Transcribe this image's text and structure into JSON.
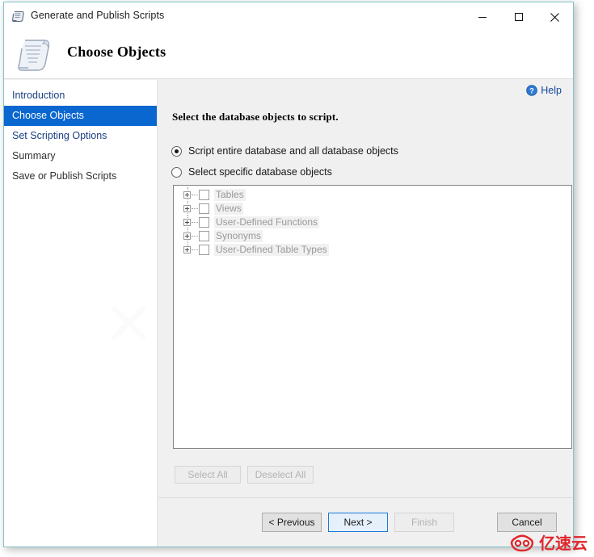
{
  "window": {
    "title": "Generate and Publish Scripts",
    "title_icon": "script-scroll-icon",
    "controls": {
      "minimize": "minimize-icon",
      "maximize": "maximize-icon",
      "close": "close-icon"
    }
  },
  "banner": {
    "heading": "Choose Objects",
    "icon": "script-scroll-large-icon"
  },
  "sidebar": {
    "items": [
      {
        "label": "Introduction",
        "selected": false
      },
      {
        "label": "Choose Objects",
        "selected": true
      },
      {
        "label": "Set Scripting Options",
        "selected": false
      },
      {
        "label": "Summary",
        "selected": false
      },
      {
        "label": "Save or Publish Scripts",
        "selected": false
      }
    ],
    "watermark_icon": "x-watermark-icon"
  },
  "content": {
    "help": {
      "label": "Help",
      "icon": "help-circle-icon"
    },
    "section_title": "Select the database objects to script.",
    "options": [
      {
        "label": "Script entire database and all database objects",
        "selected": true
      },
      {
        "label": "Select specific database objects",
        "selected": false
      }
    ],
    "tree": {
      "items": [
        {
          "label": "Tables",
          "checked": false,
          "expandable": true
        },
        {
          "label": "Views",
          "checked": false,
          "expandable": true
        },
        {
          "label": "User-Defined Functions",
          "checked": false,
          "expandable": true
        },
        {
          "label": "Synonyms",
          "checked": false,
          "expandable": true
        },
        {
          "label": "User-Defined Table Types",
          "checked": false,
          "expandable": true
        }
      ]
    },
    "select_all": {
      "label": "Select All",
      "enabled": false
    },
    "deselect_all": {
      "label": "Deselect All",
      "enabled": false
    }
  },
  "footer": {
    "previous": {
      "label": "< Previous",
      "enabled": true,
      "focused": false
    },
    "next": {
      "label": "Next >",
      "enabled": true,
      "focused": true
    },
    "finish": {
      "label": "Finish",
      "enabled": false,
      "focused": false
    },
    "cancel": {
      "label": "Cancel",
      "enabled": true,
      "focused": false
    }
  },
  "watermark": {
    "text": "亿速云",
    "icon": "cloud-logo-icon",
    "color": "#e0262c"
  },
  "colors": {
    "selection_blue": "#0a67cf",
    "link_blue": "#1a3e80",
    "window_border": "#7fc4c9",
    "focus_border": "#1879d8"
  }
}
